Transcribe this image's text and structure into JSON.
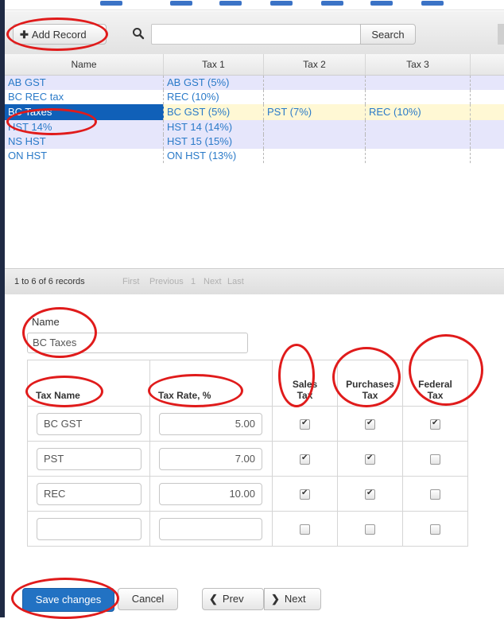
{
  "toolbar": {
    "add_label": "Add Record",
    "search_placeholder": "",
    "search_button": "Search"
  },
  "grid": {
    "columns": [
      "Name",
      "Tax 1",
      "Tax 2",
      "Tax 3"
    ],
    "rows": [
      {
        "name": "AB GST",
        "tax1": "AB GST (5%)",
        "tax2": "",
        "tax3": ""
      },
      {
        "name": "BC REC tax",
        "tax1": "REC (10%)",
        "tax2": "",
        "tax3": ""
      },
      {
        "name": "BC Taxes",
        "tax1": "BC GST (5%)",
        "tax2": "PST (7%)",
        "tax3": "REC (10%)"
      },
      {
        "name": "HST 14%",
        "tax1": "HST 14 (14%)",
        "tax2": "",
        "tax3": ""
      },
      {
        "name": "NS HST",
        "tax1": "HST 15 (15%)",
        "tax2": "",
        "tax3": ""
      },
      {
        "name": "ON HST",
        "tax1": "ON HST (13%)",
        "tax2": "",
        "tax3": ""
      }
    ],
    "selected_index": 2
  },
  "pager": {
    "count": "1 to 6 of 6 records",
    "first": "First",
    "previous": "Previous",
    "page": "1",
    "next": "Next",
    "last": "Last"
  },
  "form": {
    "name_label": "Name",
    "name_value": "BC Taxes",
    "headers": {
      "tax_name": "Tax Name",
      "tax_rate": "Tax Rate, %",
      "sales_1": "Sales",
      "sales_2": "Tax",
      "purchases_1": "Purchases",
      "purchases_2": "Tax",
      "federal_1": "Federal",
      "federal_2": "Tax"
    },
    "taxes": [
      {
        "name": "BC GST",
        "rate": "5.00",
        "sales": true,
        "purchases": true,
        "federal": true
      },
      {
        "name": "PST",
        "rate": "7.00",
        "sales": true,
        "purchases": true,
        "federal": false
      },
      {
        "name": "REC",
        "rate": "10.00",
        "sales": true,
        "purchases": true,
        "federal": false
      },
      {
        "name": "",
        "rate": "",
        "sales": false,
        "purchases": false,
        "federal": false
      }
    ]
  },
  "footer": {
    "save": "Save changes",
    "cancel": "Cancel",
    "prev": "Prev",
    "next": "Next"
  },
  "colors": {
    "selected_row": "#1060b8",
    "link_text": "#2a7ac8",
    "annotation": "#e01b1b",
    "save_button": "#2272c3"
  }
}
